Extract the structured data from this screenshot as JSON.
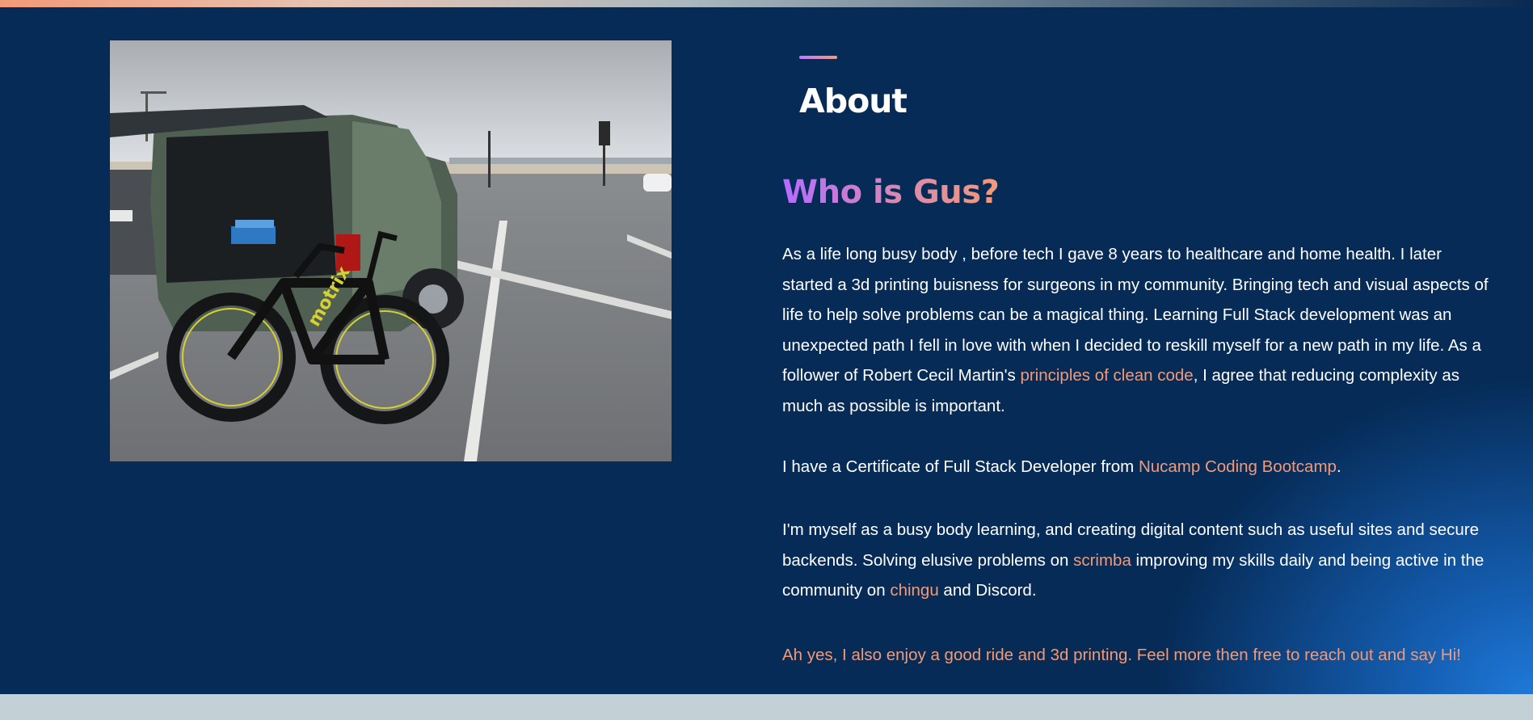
{
  "about": {
    "heading": "About",
    "subheading": "Who is Gus?"
  },
  "paragraph1": {
    "before_link": "As a life long busy body , before tech I gave 8 years to healthcare and home health. I later started a 3d printing buisness for surgeons in my community. Bringing tech and visual aspects of life to help solve problems can be a magical thing. Learning Full Stack development was an unexpected path I fell in love with when I decided to reskill myself for a new path in my life. As a follower of Robert Cecil Martin's ",
    "link": "principles of clean code",
    "after_link": ", I agree that reducing complexity as much as possible is important."
  },
  "paragraph2": {
    "before_link": "I have a Certificate of Full Stack Developer from ",
    "link": "Nucamp Coding Bootcamp",
    "after_link": "."
  },
  "paragraph3": {
    "part1": "I'm myself as a busy body learning, and creating digital content such as useful sites and secure backends. Solving elusive problems on ",
    "link1": "scrimba",
    "part2": " improving my skills daily and being active in the community on ",
    "link2": "chingu",
    "part3": " and Discord."
  },
  "paragraph4": {
    "text": "Ah yes, I also enjoy a good ride and 3d printing. Feel more then free to reach out and say Hi!"
  },
  "photo": {
    "subject": "bicycle-and-suv-parking-lot",
    "bike_brand": "motrix"
  },
  "colors": {
    "background": "#062b57",
    "accent": "#f29a77",
    "title_gradient_start": "#b46cff",
    "text": "#ffffff",
    "page_footer": "#c3d0d6"
  }
}
